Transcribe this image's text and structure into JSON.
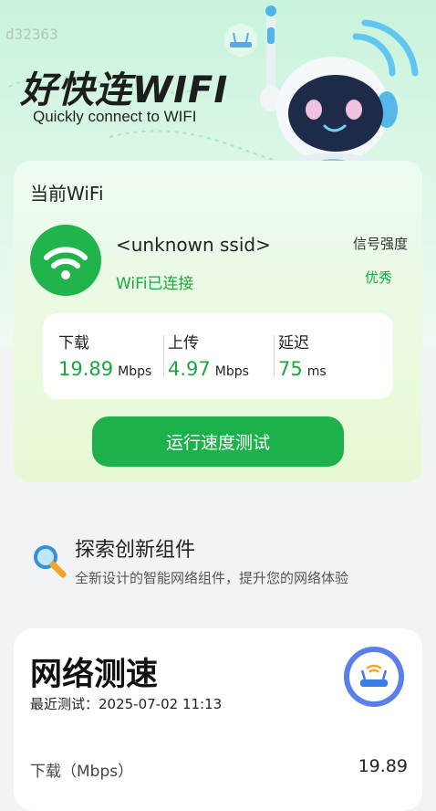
{
  "watermark": "d32363",
  "brand": {
    "title": "好快连WIFI",
    "subtitle": "Quickly connect to WIFI"
  },
  "wifi_card": {
    "title": "当前WiFi",
    "ssid": "<unknown ssid>",
    "status": "WiFi已连接",
    "signal_label": "信号强度",
    "signal_value": "优秀",
    "stats": {
      "download": {
        "label": "下载",
        "value": "19.89",
        "unit": "Mbps"
      },
      "upload": {
        "label": "上传",
        "value": "4.97",
        "unit": "Mbps"
      },
      "latency": {
        "label": "延迟",
        "value": "75",
        "unit": "ms"
      }
    },
    "run_button": "运行速度测试"
  },
  "explore": {
    "title": "探索创新组件",
    "subtitle": "全新设计的智能网络组件，提升您的网络体验"
  },
  "speed_card": {
    "title": "网络测速",
    "last_test": "最近测试：2025-07-02 11:13",
    "download_label": "下载（Mbps）",
    "download_value": "19.89"
  },
  "colors": {
    "accent_green": "#1db14b",
    "text_green": "#1aa640"
  },
  "icons": [
    "wifi-icon",
    "robot-illustration",
    "search-icon",
    "router-icon"
  ]
}
